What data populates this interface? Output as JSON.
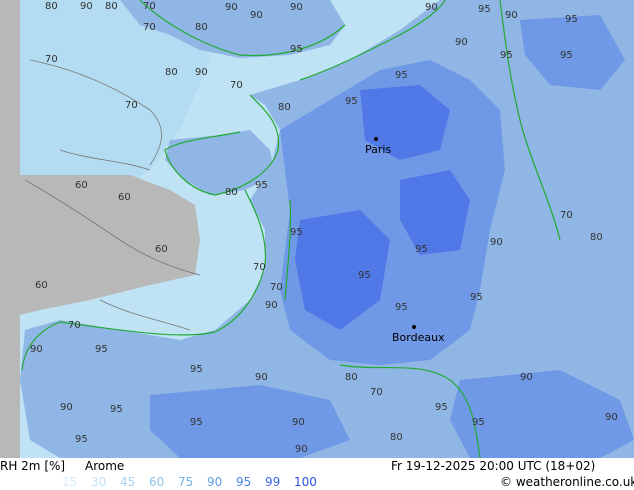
{
  "title": {
    "parameter": "RH 2m [%]",
    "model": "Arome",
    "valid_time": "Fr 19-12-2025 20:00 UTC (18+02)",
    "credit": "© weatheronline.co.uk"
  },
  "legend": {
    "levels": [
      "15",
      "30",
      "45",
      "60",
      "75",
      "90",
      "95",
      "99",
      "100"
    ],
    "colors": [
      "#d8ecf8",
      "#c2e0f4",
      "#a8d2ee",
      "#8ec4ea",
      "#77b4e6",
      "#629fe4",
      "#4d82e6",
      "#3b67e6",
      "#2e4fdf"
    ]
  },
  "map": {
    "colors": {
      "sea_high": "#bfe3f4",
      "sea_mid": "#a8d4ee",
      "land_90": "#8fb6e4",
      "land_95": "#6f99e6",
      "land_99": "#5078e6",
      "masked": "#b8b8b8",
      "coast": "#22aa33",
      "contour": "#777777"
    },
    "cities": [
      {
        "id": "paris",
        "name": "Paris"
      },
      {
        "id": "bordeaux",
        "name": "Bordeaux"
      }
    ],
    "contour_labels": [
      {
        "id": "l1",
        "v": "80"
      },
      {
        "id": "l2",
        "v": "90"
      },
      {
        "id": "l3",
        "v": "80"
      },
      {
        "id": "l4",
        "v": "70"
      },
      {
        "id": "l5",
        "v": "90"
      },
      {
        "id": "l6",
        "v": "90"
      },
      {
        "id": "l7",
        "v": "90"
      },
      {
        "id": "l8",
        "v": "95"
      },
      {
        "id": "l9",
        "v": "90"
      },
      {
        "id": "l10",
        "v": "95"
      },
      {
        "id": "l11",
        "v": "70"
      },
      {
        "id": "l12",
        "v": "80"
      },
      {
        "id": "l13",
        "v": "90"
      },
      {
        "id": "l14",
        "v": "95"
      },
      {
        "id": "l15",
        "v": "90"
      },
      {
        "id": "l16",
        "v": "95"
      },
      {
        "id": "l17",
        "v": "95"
      },
      {
        "id": "l18",
        "v": "70"
      },
      {
        "id": "l19",
        "v": "70"
      },
      {
        "id": "l20",
        "v": "90"
      },
      {
        "id": "l21",
        "v": "80"
      },
      {
        "id": "l22",
        "v": "95"
      },
      {
        "id": "l23",
        "v": "70"
      },
      {
        "id": "l24",
        "v": "80"
      },
      {
        "id": "l25",
        "v": "95"
      },
      {
        "id": "l26",
        "v": "60"
      },
      {
        "id": "l27",
        "v": "60"
      },
      {
        "id": "l28",
        "v": "80"
      },
      {
        "id": "l29",
        "v": "95"
      },
      {
        "id": "l30",
        "v": "60"
      },
      {
        "id": "l31",
        "v": "60"
      },
      {
        "id": "l32",
        "v": "70"
      },
      {
        "id": "l33",
        "v": "95"
      },
      {
        "id": "l34",
        "v": "90"
      },
      {
        "id": "l35",
        "v": "95"
      },
      {
        "id": "l36",
        "v": "95"
      },
      {
        "id": "l37",
        "v": "90"
      },
      {
        "id": "l38",
        "v": "95"
      },
      {
        "id": "l39",
        "v": "95"
      },
      {
        "id": "l40",
        "v": "70"
      },
      {
        "id": "l41",
        "v": "80"
      },
      {
        "id": "l42",
        "v": "70"
      },
      {
        "id": "l43",
        "v": "90"
      },
      {
        "id": "l44",
        "v": "95"
      },
      {
        "id": "l45",
        "v": "95"
      },
      {
        "id": "l46",
        "v": "90"
      },
      {
        "id": "l47",
        "v": "80"
      },
      {
        "id": "l48",
        "v": "70"
      },
      {
        "id": "l49",
        "v": "90"
      },
      {
        "id": "l50",
        "v": "95"
      },
      {
        "id": "l51",
        "v": "90"
      },
      {
        "id": "l52",
        "v": "95"
      },
      {
        "id": "l53",
        "v": "95"
      },
      {
        "id": "l54",
        "v": "90"
      },
      {
        "id": "l55",
        "v": "95"
      },
      {
        "id": "l56",
        "v": "90"
      },
      {
        "id": "l57",
        "v": "95"
      },
      {
        "id": "l58",
        "v": "90"
      },
      {
        "id": "l59",
        "v": "80"
      },
      {
        "id": "l60",
        "v": "70"
      }
    ]
  }
}
